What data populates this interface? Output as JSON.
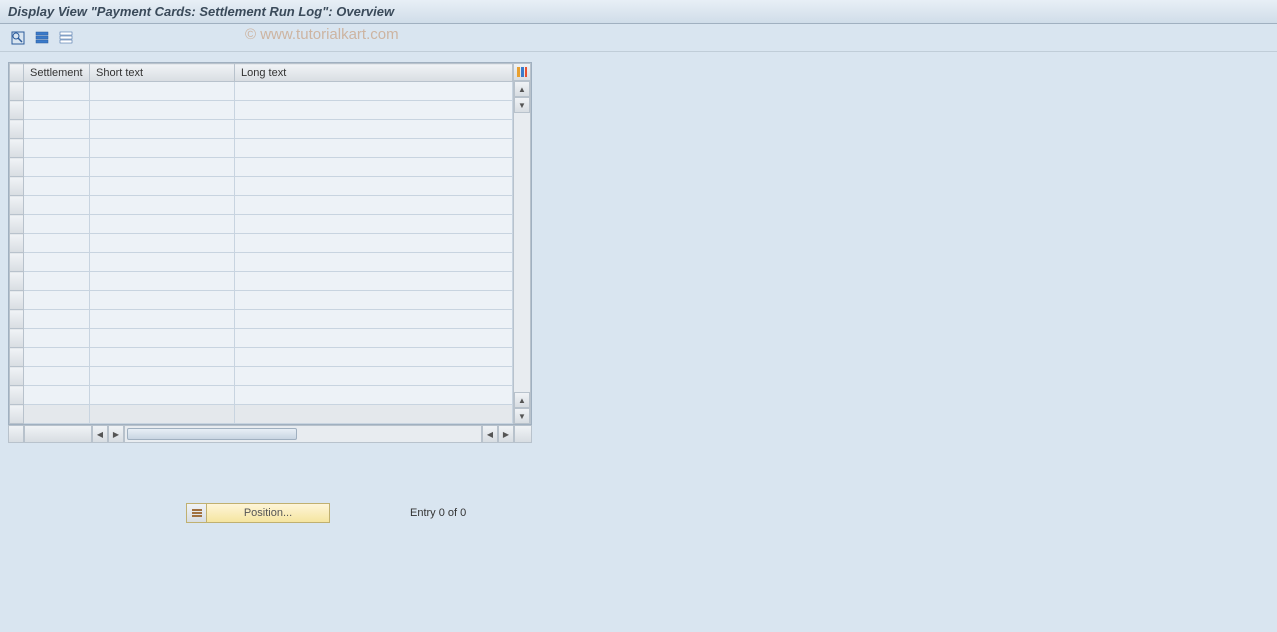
{
  "header": {
    "title": "Display View \"Payment Cards: Settlement Run Log\": Overview"
  },
  "watermark": "© www.tutorialkart.com",
  "toolbar": {
    "icons": {
      "details": "details-icon",
      "select_all": "select-all-icon",
      "deselect_all": "deselect-all-icon"
    }
  },
  "grid": {
    "columns": {
      "settlement": "Settlement",
      "short_text": "Short text",
      "long_text": "Long text"
    },
    "row_count": 18
  },
  "footer": {
    "position_label": "Position...",
    "entry_status": "Entry 0 of 0"
  }
}
